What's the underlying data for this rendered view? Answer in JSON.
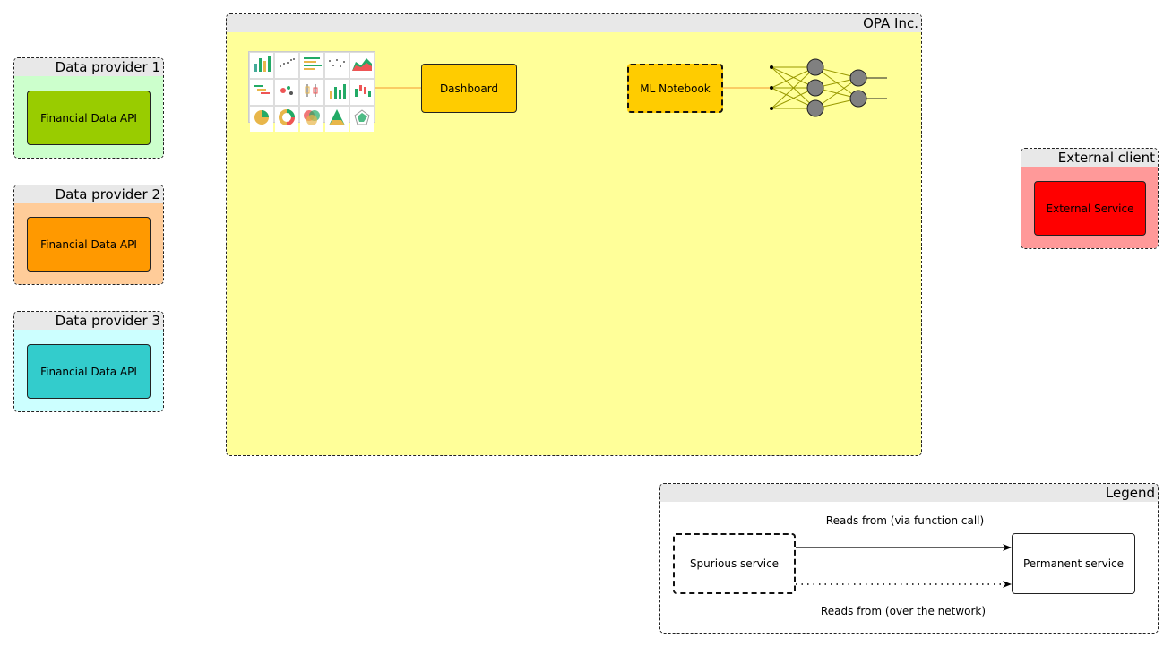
{
  "opa": {
    "title": "OPA Inc.",
    "color": "#ffff99"
  },
  "providers": [
    {
      "title": "Data provider 1",
      "service": "Financial Data API",
      "bg": "#ccffcc",
      "fill": "#99cc00"
    },
    {
      "title": "Data provider 2",
      "service": "Financial Data API",
      "bg": "#ffcc99",
      "fill": "#ff9900"
    },
    {
      "title": "Data provider 3",
      "service": "Financial Data API",
      "bg": "#ccffff",
      "fill": "#33cccc"
    }
  ],
  "dashboard": {
    "label": "Dashboard",
    "fill": "#ffcc00"
  },
  "notebook": {
    "label": "ML Notebook",
    "fill": "#ffcc00"
  },
  "external": {
    "title": "External client",
    "service": "External Service",
    "bg": "#ff9999",
    "fill": "#ff0000"
  },
  "legend": {
    "title": "Legend",
    "spurious": "Spurious service",
    "permanent": "Permanent service",
    "function_call": "Reads from (via function call)",
    "network": "Reads from (over the network)"
  },
  "icons": {
    "charts": "chart-thumbnails-icon",
    "network": "neural-network-icon"
  }
}
